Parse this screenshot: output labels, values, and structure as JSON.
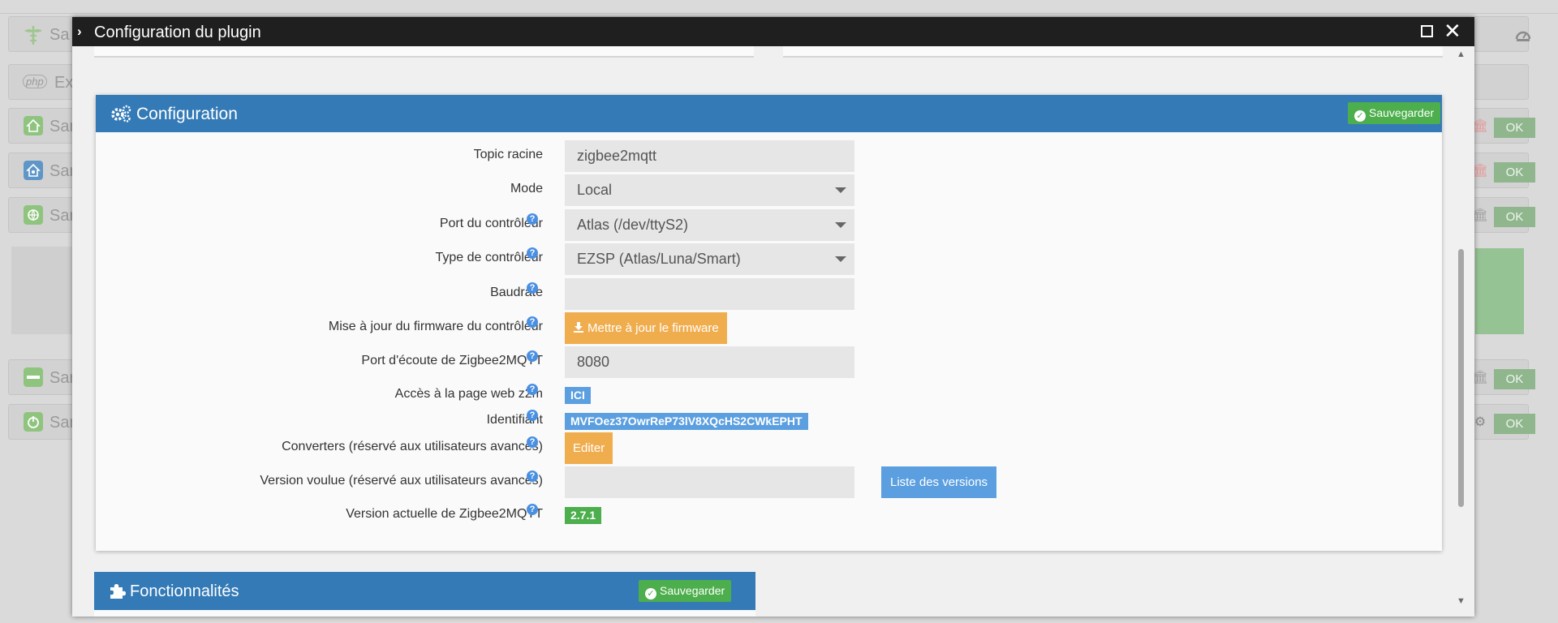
{
  "background": {
    "rows": [
      {
        "text": "Sa",
        "icon": "caduceus-icon",
        "color": "#9fc68e"
      },
      {
        "text": "Ex",
        "icon": "php-icon",
        "color": "#b9b9b9"
      },
      {
        "text": "Sar",
        "icon": "home-icon",
        "color": "#8fc47e"
      },
      {
        "text": "Sar",
        "icon": "home-shield-icon",
        "color": "#5f96c8"
      },
      {
        "text": "Sar",
        "icon": "globe-icon",
        "color": "#8fc47e"
      },
      {
        "text": "Sar",
        "icon": "mqtt-icon",
        "color": "#8fc47e"
      },
      {
        "text": "Sar",
        "icon": "power-icon",
        "color": "#8fc47e"
      }
    ],
    "php_label": "php",
    "ok_label": "OK"
  },
  "modal": {
    "title": "Configuration du plugin"
  },
  "config_panel": {
    "title": "Configuration",
    "save_label": "Sauvegarder",
    "fields": {
      "topic_racine": {
        "label": "Topic racine",
        "value": "zigbee2mqtt"
      },
      "mode": {
        "label": "Mode",
        "value": "Local"
      },
      "port_controleur": {
        "label": "Port du contrôleur",
        "value": "Atlas (/dev/ttyS2)"
      },
      "type_controleur": {
        "label": "Type de contrôleur",
        "value": "EZSP (Atlas/Luna/Smart)"
      },
      "baudrate": {
        "label": "Baudrate",
        "value": ""
      },
      "firmware": {
        "label": "Mise à jour du firmware du contrôleur",
        "button": "Mettre à jour le firmware"
      },
      "port_ecoute": {
        "label": "Port d'écoute de Zigbee2MQTT",
        "value": "8080"
      },
      "acces_web": {
        "label": "Accès à la page web z2m",
        "badge": "ICI"
      },
      "identifiant": {
        "label": "Identifiant",
        "badge": "MVFOez37OwrReP73lV8XQcHS2CWkEPHT"
      },
      "converters": {
        "label": "Converters (réservé aux utilisateurs avancés)",
        "button": "Editer"
      },
      "version_voulue": {
        "label": "Version voulue (réservé aux utilisateurs avancés)",
        "value": "",
        "button": "Liste des versions"
      },
      "version_actuelle": {
        "label": "Version actuelle de Zigbee2MQTT",
        "badge": "2.7.1"
      }
    }
  },
  "fonctionnalites_panel": {
    "title": "Fonctionnalités",
    "save_label": "Sauvegarder"
  },
  "help_glyph": "?",
  "colors": {
    "primary": "#337ab7",
    "success": "#4cae4c",
    "warning": "#f0ad4e",
    "info": "#5b9fe0",
    "titlebar": "#1f1f1f"
  }
}
